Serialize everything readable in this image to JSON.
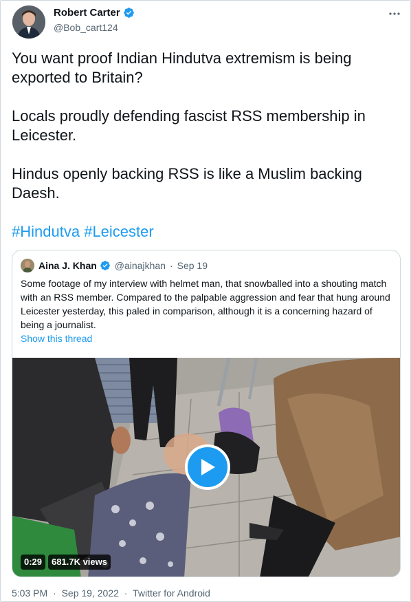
{
  "tweet": {
    "author_name": "Robert Carter",
    "author_handle": "@Bob_cart124",
    "paragraphs": [
      "You want proof Indian Hindutva extremism is being exported to Britain?",
      "Locals proudly defending fascist RSS membership in Leicester.",
      "Hindus openly backing RSS is like a Muslim backing Daesh."
    ],
    "hashtags": [
      "#Hindutva",
      "#Leicester"
    ],
    "time": "5:03 PM",
    "date": "Sep 19, 2022",
    "source": "Twitter for Android",
    "separator": "·"
  },
  "quote": {
    "author_name": "Aina J. Khan",
    "author_handle": "@ainajkhan",
    "date": "Sep 19",
    "separator": "·",
    "text": "Some footage of my interview with helmet man, that snowballed into a shouting match with an RSS member. Compared to the palpable aggression and fear that hung around Leicester yesterday, this paled in comparison, although it is a concerning hazard of being a journalist.",
    "show_thread": "Show this thread",
    "video": {
      "duration": "0:29",
      "views": "681.7K views"
    }
  },
  "icons": {
    "verified": "verified-badge-icon",
    "more": "more-options-icon",
    "play": "play-icon"
  },
  "colors": {
    "link": "#1d9bf0",
    "secondary_text": "#536471",
    "border": "#cfd9de"
  }
}
